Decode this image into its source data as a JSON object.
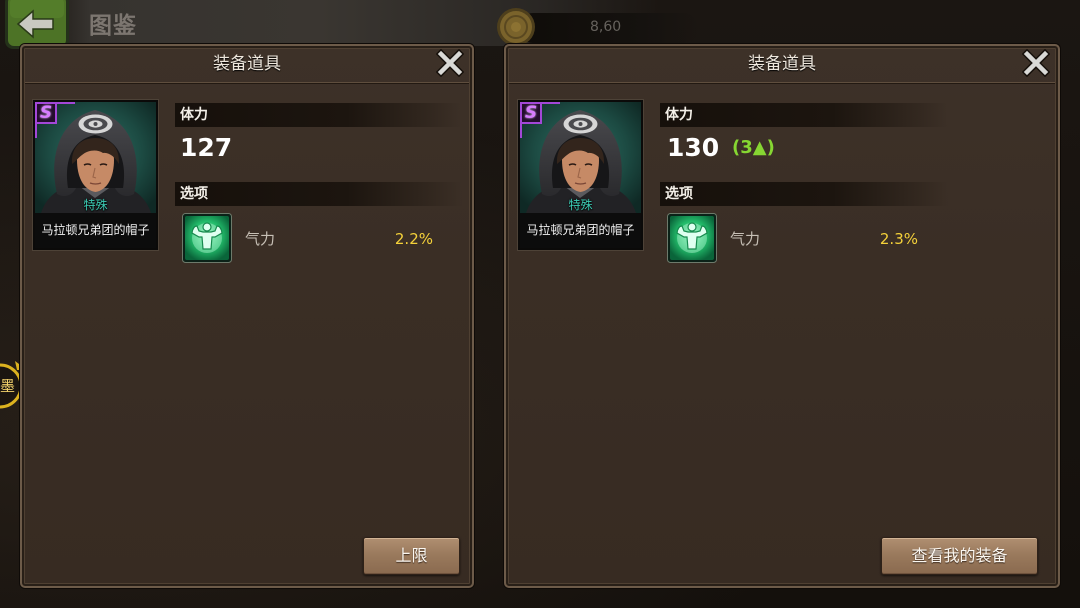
{
  "topbar": {
    "back_icon": "back-arrow-icon",
    "title": "图鉴",
    "currency_icon": "coin-icon",
    "currency_value": "8,60"
  },
  "side_badge": {
    "icon": "crown-icon",
    "label": "墨"
  },
  "panels": [
    {
      "title": "装备道具",
      "close_icon": "close-icon",
      "item": {
        "grade": "S",
        "type": "特殊",
        "name": "马拉顿兄弟团的帽子"
      },
      "stat": {
        "label": "体力",
        "value": "127"
      },
      "options_label": "选项",
      "options": [
        {
          "icon": "strength-icon",
          "name": "气力",
          "value": "2.2%"
        }
      ],
      "button_label": "上限"
    },
    {
      "title": "装备道具",
      "close_icon": "close-icon",
      "item": {
        "grade": "S",
        "type": "特殊",
        "name": "马拉顿兄弟团的帽子"
      },
      "stat": {
        "label": "体力",
        "value": "130",
        "change": "(3▲)"
      },
      "options_label": "选项",
      "options": [
        {
          "icon": "strength-icon",
          "name": "气力",
          "value": "2.3%"
        }
      ],
      "button_label": "查看我的装备"
    }
  ],
  "colors": {
    "panel_bg": "#3a2e25",
    "panel_border": "#6d5b49",
    "grade_purple": "#a347d8",
    "item_type_teal": "#3ccbb4",
    "stat_increase_green": "#86d632",
    "option_value_yellow": "#f4d13a",
    "button_bg": "#9a7a5d",
    "back_button_green": "#4d7326"
  }
}
